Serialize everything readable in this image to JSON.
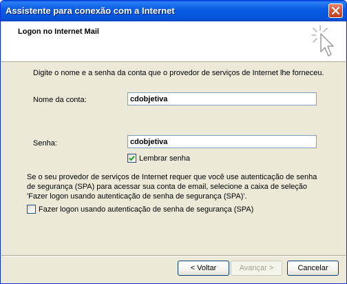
{
  "window": {
    "title": "Assistente para conexão com a Internet"
  },
  "header": {
    "title": "Logon no Internet Mail",
    "icon": "wizard-cursor-sparkle-icon"
  },
  "form": {
    "intro": "Digite o nome e a senha da conta que o provedor de serviços de Internet lhe forneceu.",
    "account_label": "Nome da conta:",
    "account_value": "cdobjetiva",
    "password_label": "Senha:",
    "password_value": "cdobjetiva",
    "remember_label": "Lembrar senha",
    "remember_checked": true,
    "spa_paragraph_line1": "Se o seu provedor de serviços de Internet requer que você use autenticação de senha",
    "spa_paragraph_line2": "de segurança (SPA) para acessar sua conta de email, selecione a caixa de seleção",
    "spa_paragraph_line3": "'Fazer logon usando autenticação de senha de segurança (SPA)'.",
    "spa_label": "Fazer logon usando autenticação de senha de segurança (SPA)",
    "spa_checked": false
  },
  "buttons": {
    "back": "< Voltar",
    "next": "Avançar >",
    "cancel": "Cancelar"
  },
  "colors": {
    "titlebar": "#0453d8",
    "face": "#ece9d8",
    "check": "#21a121"
  }
}
